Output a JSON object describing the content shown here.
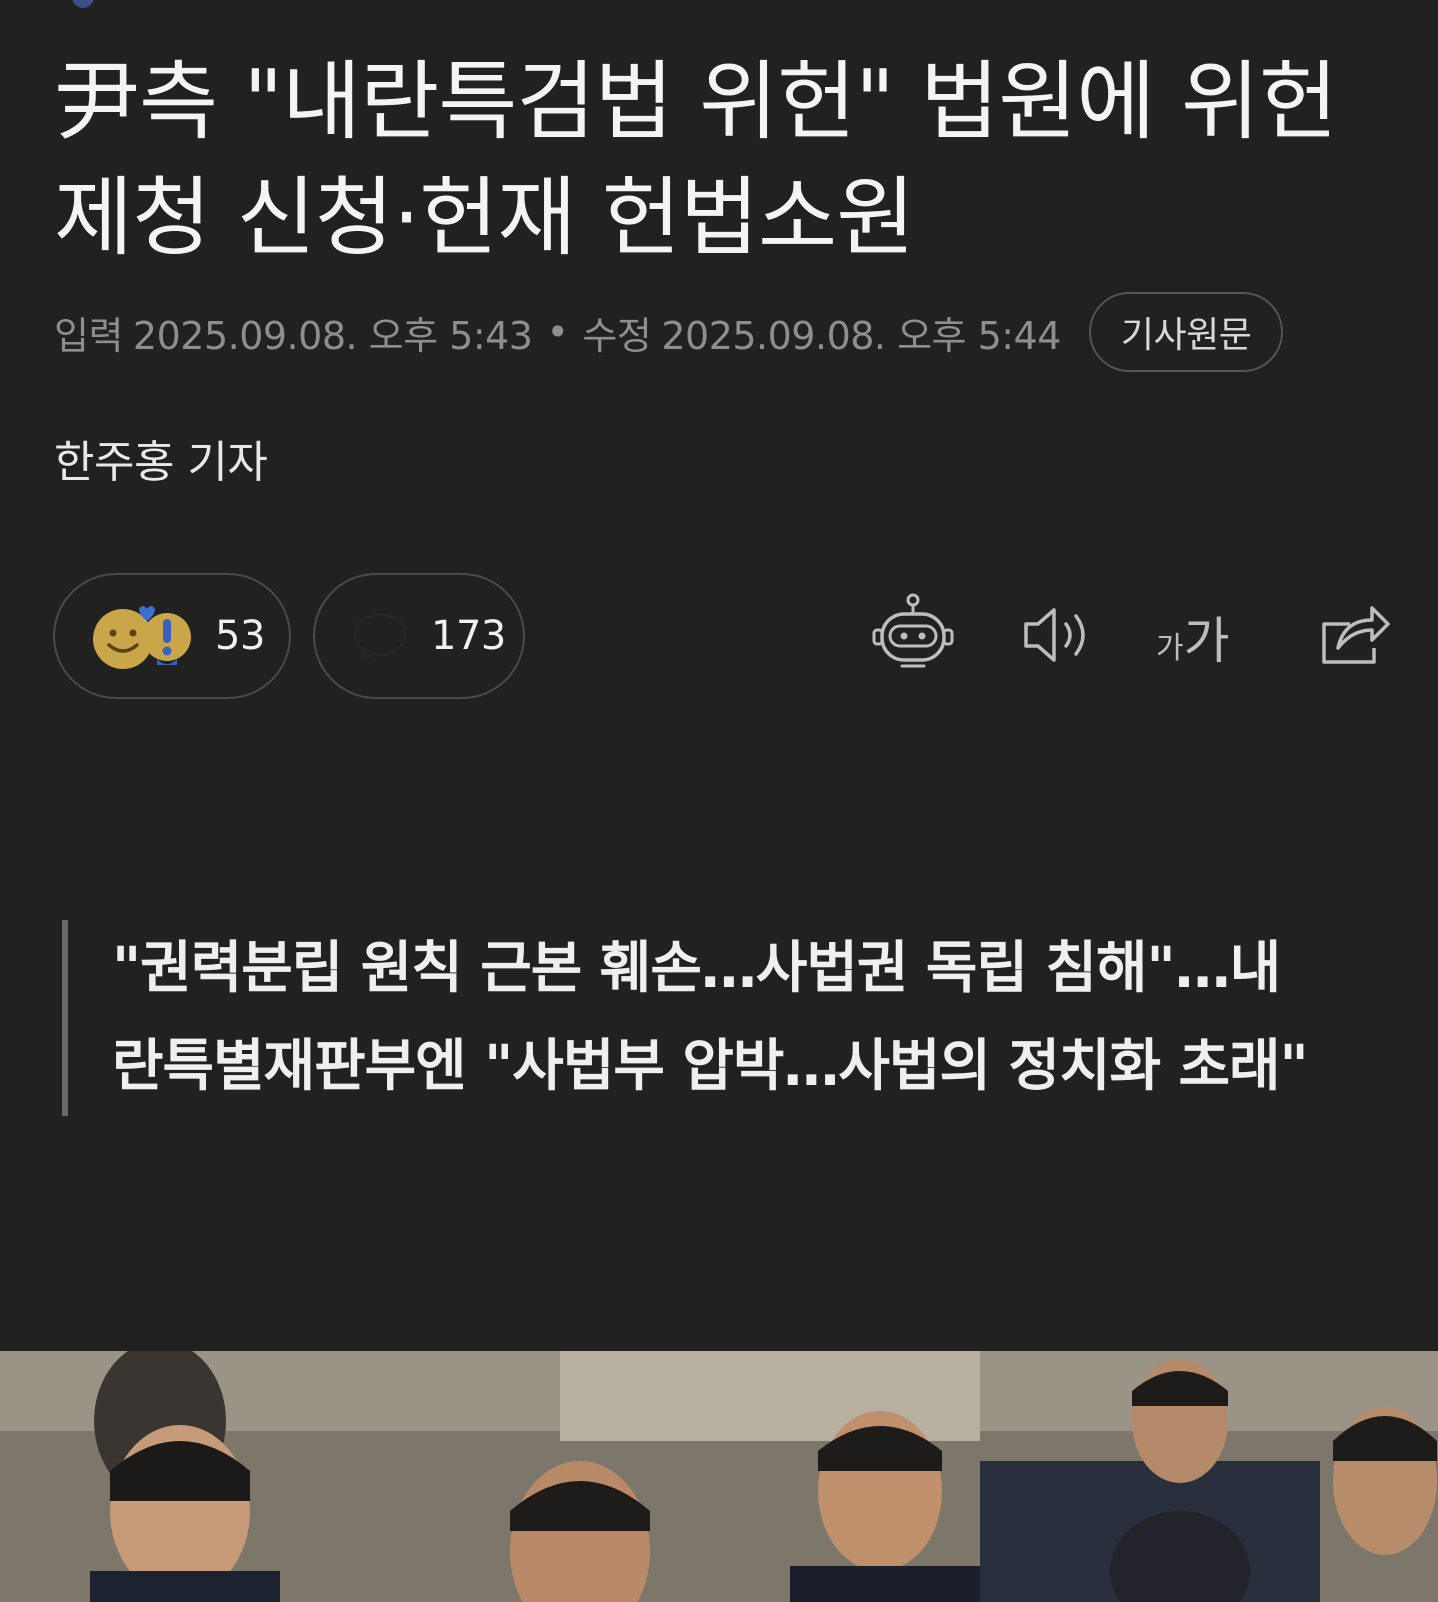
{
  "article": {
    "headline": "尹측 \"내란특검법 위헌\" 법원에 위헌\n제청 신청·헌재 헌법소원",
    "meta": {
      "input_label": "입력",
      "input_time": "2025.09.08. 오후 5:43",
      "separator": "•",
      "modified_label": "수정",
      "modified_time": "2025.09.08. 오후 5:44",
      "original_button": "기사원문"
    },
    "byline": "한주홍 기자",
    "reactions": {
      "count": "53",
      "icons": [
        "smile-emoji-icon",
        "surprise-emoji-icon"
      ]
    },
    "comments": {
      "count": "173",
      "icon": "comment-bubble-icon"
    },
    "tools": {
      "summary_icon": "robot-icon",
      "audio_icon": "speaker-icon",
      "font_size_icon": "font-size-icon",
      "font_size_glyph_small": "가",
      "font_size_glyph_large": "가",
      "share_icon": "share-icon"
    },
    "subheadline": "\"권력분립 원칙 근본 훼손…사법권 독립 침해\"…내\n란특별재판부엔 \"사법부 압박…사법의 정치화 초래\"",
    "colors": {
      "background": "#212121",
      "text": "#f2f2f2",
      "muted": "#8e8e8e",
      "border": "#4a4a4a"
    }
  }
}
